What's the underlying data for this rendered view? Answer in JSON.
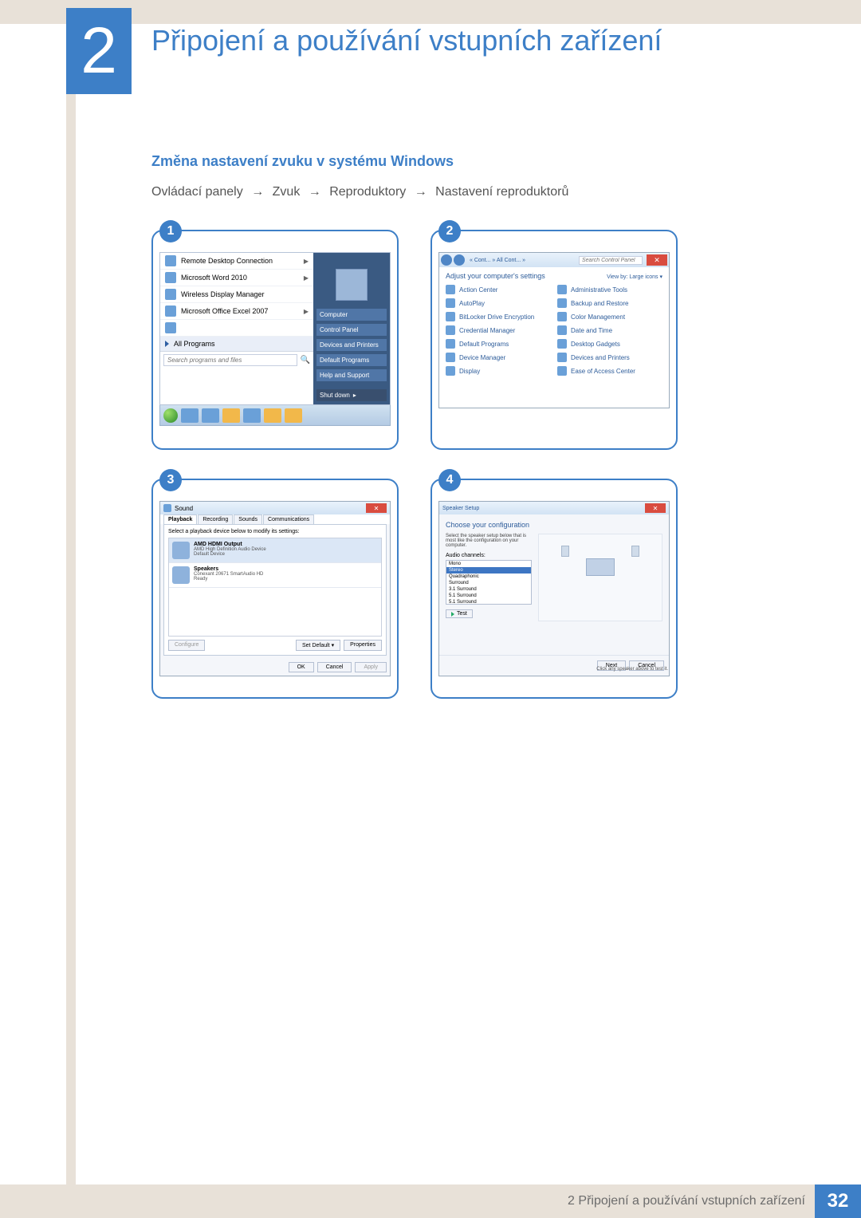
{
  "chapter": {
    "number": "2",
    "title": "Připojení a používání vstupních zařízení"
  },
  "section": {
    "title": "Změna nastavení zvuku v systému Windows"
  },
  "path": {
    "steps": [
      "Ovládací panely",
      "Zvuk",
      "Reproduktory",
      "Nastavení reproduktorů"
    ]
  },
  "panels": {
    "n1": "1",
    "n2": "2",
    "n3": "3",
    "n4": "4"
  },
  "startmenu": {
    "items": [
      {
        "label": "Remote Desktop Connection",
        "chev": "▶"
      },
      {
        "label": "Microsoft Word 2010",
        "chev": "▶"
      },
      {
        "label": "Wireless Display Manager",
        "chev": ""
      },
      {
        "label": "Microsoft Office Excel 2007",
        "chev": "▶"
      }
    ],
    "all_programs": "All Programs",
    "search_placeholder": "Search programs and files",
    "right": {
      "tiles": [
        "Computer",
        "Control Panel",
        "Devices and Printers",
        "Default Programs",
        "Help and Support"
      ],
      "shutdown": "Shut down"
    }
  },
  "cp": {
    "breadcrumb": "« Cont... » All Cont... »",
    "search_placeholder": "Search Control Panel",
    "heading": "Adjust your computer's settings",
    "view_by": "View by:  Large icons ▾",
    "links": [
      "Action Center",
      "Administrative Tools",
      "AutoPlay",
      "Backup and Restore",
      "BitLocker Drive Encryption",
      "Color Management",
      "Credential Manager",
      "Date and Time",
      "Default Programs",
      "Desktop Gadgets",
      "Device Manager",
      "Devices and Printers",
      "Display",
      "Ease of Access Center"
    ]
  },
  "snd": {
    "title": "Sound",
    "tabs": [
      "Playback",
      "Recording",
      "Sounds",
      "Communications"
    ],
    "instruction": "Select a playback device below to modify its settings:",
    "devices": [
      {
        "name": "AMD HDMI Output",
        "desc1": "AMD High Definition Audio Device",
        "desc2": "Default Device"
      },
      {
        "name": "Speakers",
        "desc1": "Conexant 20671 SmartAudio HD",
        "desc2": "Ready"
      }
    ],
    "buttons": {
      "configure": "Configure",
      "set_default": "Set Default ▾",
      "properties": "Properties",
      "ok": "OK",
      "cancel": "Cancel",
      "apply": "Apply"
    }
  },
  "sps": {
    "title": "Speaker Setup",
    "heading": "Choose your configuration",
    "instruction": "Select the speaker setup below that is most like the configuration on your computer.",
    "label": "Audio channels:",
    "options": [
      "Mono",
      "Stereo",
      "Quadraphonic",
      "Surround",
      "3.1 Surround",
      "5.1 Surround",
      "5.1 Surround"
    ],
    "selected_index": 1,
    "test": "Test",
    "hint": "Click any speaker above to test it.",
    "buttons": {
      "next": "Next",
      "cancel": "Cancel"
    }
  },
  "footer": {
    "text": "2 Připojení a používání vstupních zařízení",
    "page": "32"
  }
}
